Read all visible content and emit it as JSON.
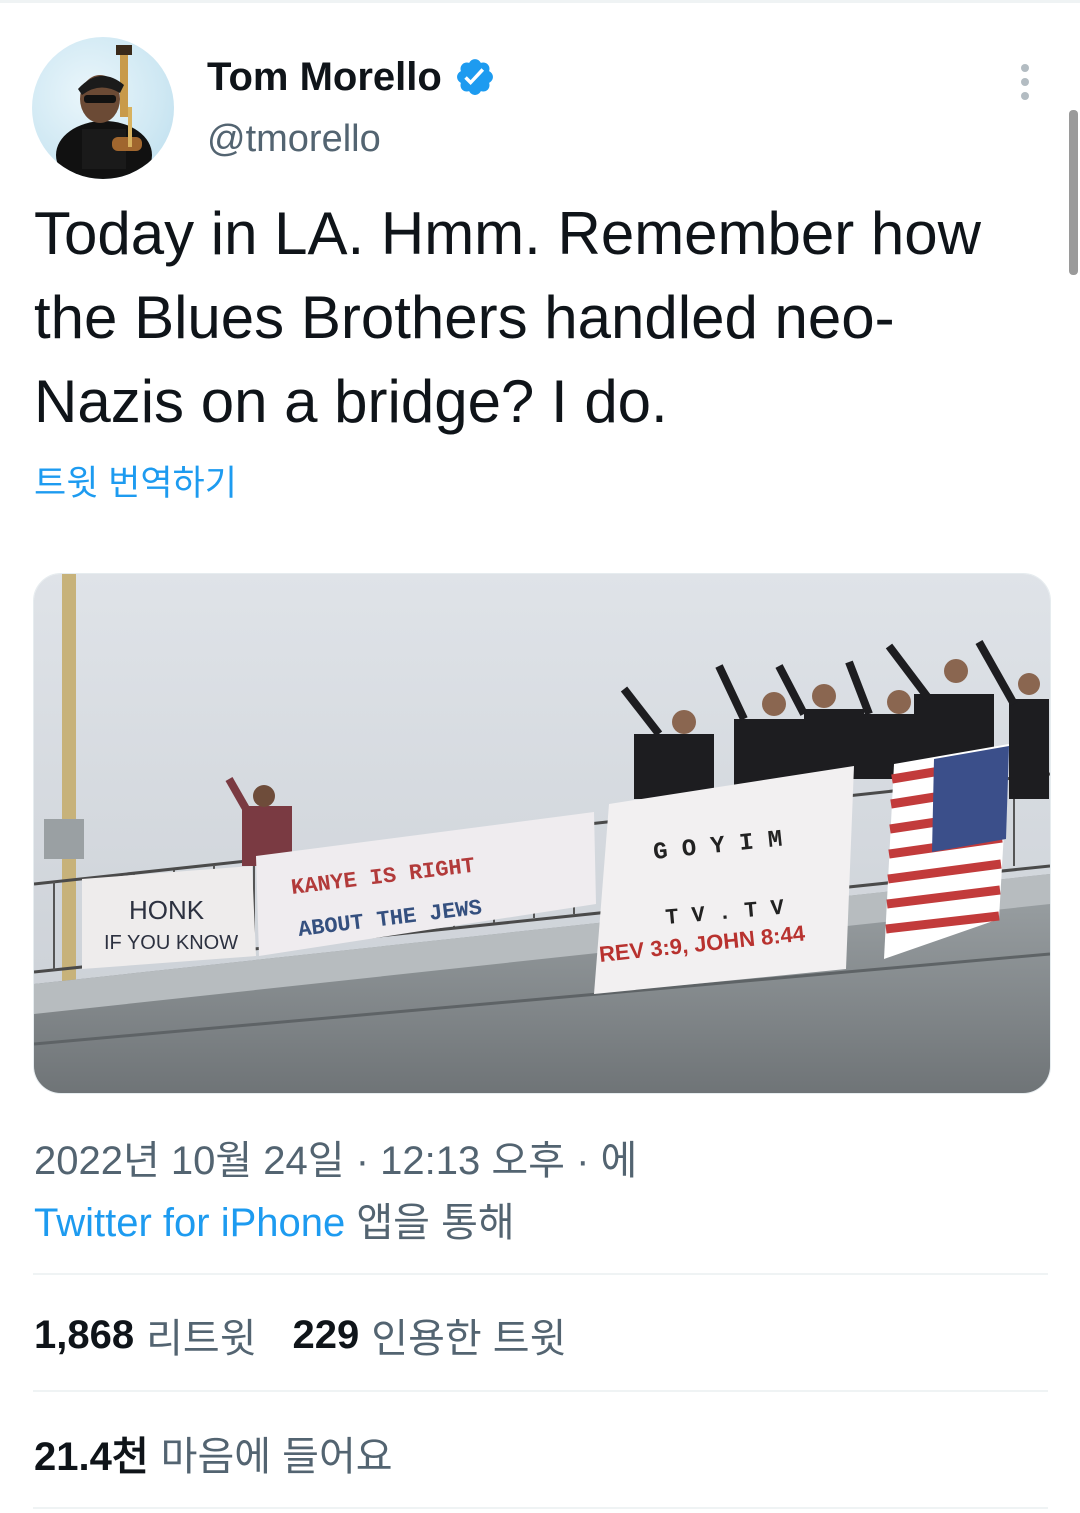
{
  "author": {
    "name": "Tom Morello",
    "handle": "@tmorello",
    "verified": true,
    "avatar_icon": "avatar-guitarist-photo"
  },
  "tweet": {
    "text": "Today in LA. Hmm. Remember how the Blues Brothers handled neo-Nazis on a bridge? I do.",
    "translate_label": "트윗 번역하기"
  },
  "media": {
    "banners": [
      {
        "line1": "HONK",
        "line2": "IF YOU KNOW"
      },
      {
        "line1": "KANYE IS RIGHT",
        "line2": "ABOUT THE JEWS"
      },
      {
        "line1": "G O Y I M",
        "line2": "T V . T V",
        "line3": "REV 3:9, JOHN 8:44"
      }
    ]
  },
  "meta": {
    "timestamp": "2022년 10월 24일 · 12:13 오후 · 에",
    "source_app": "Twitter for iPhone",
    "source_suffix": " 앱을 통해"
  },
  "stats": {
    "retweets_count": "1,868",
    "retweets_label": "리트윗",
    "quotes_count": "229",
    "quotes_label": "인용한 트윗",
    "likes_count": "21.4천",
    "likes_label": "마음에 들어요"
  },
  "colors": {
    "accent": "#1d9bf0",
    "secondary_text": "#536471",
    "primary_text": "#0f1419"
  }
}
